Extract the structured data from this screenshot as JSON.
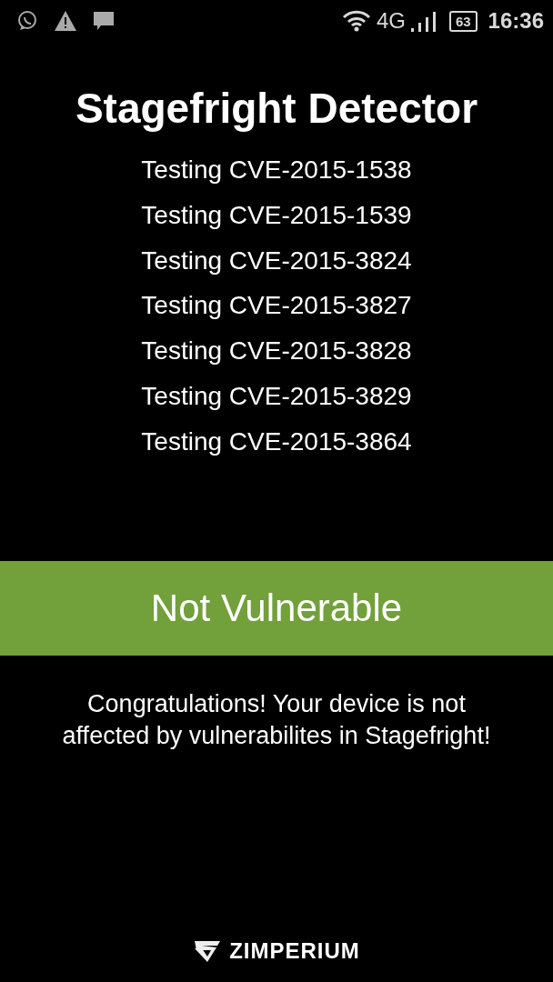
{
  "status_bar": {
    "network": "4G",
    "battery": "63",
    "time": "16:36"
  },
  "title": "Stagefright Detector",
  "tests": [
    "Testing CVE-2015-1538",
    "Testing CVE-2015-1539",
    "Testing CVE-2015-3824",
    "Testing CVE-2015-3827",
    "Testing CVE-2015-3828",
    "Testing CVE-2015-3829",
    "Testing CVE-2015-3864"
  ],
  "result": {
    "label": "Not Vulnerable",
    "vulnerable": false
  },
  "message": "Congratulations! Your device is not affected by vulnerabilites in Stagefright!",
  "footer": {
    "brand": "ZIMPERIUM"
  }
}
